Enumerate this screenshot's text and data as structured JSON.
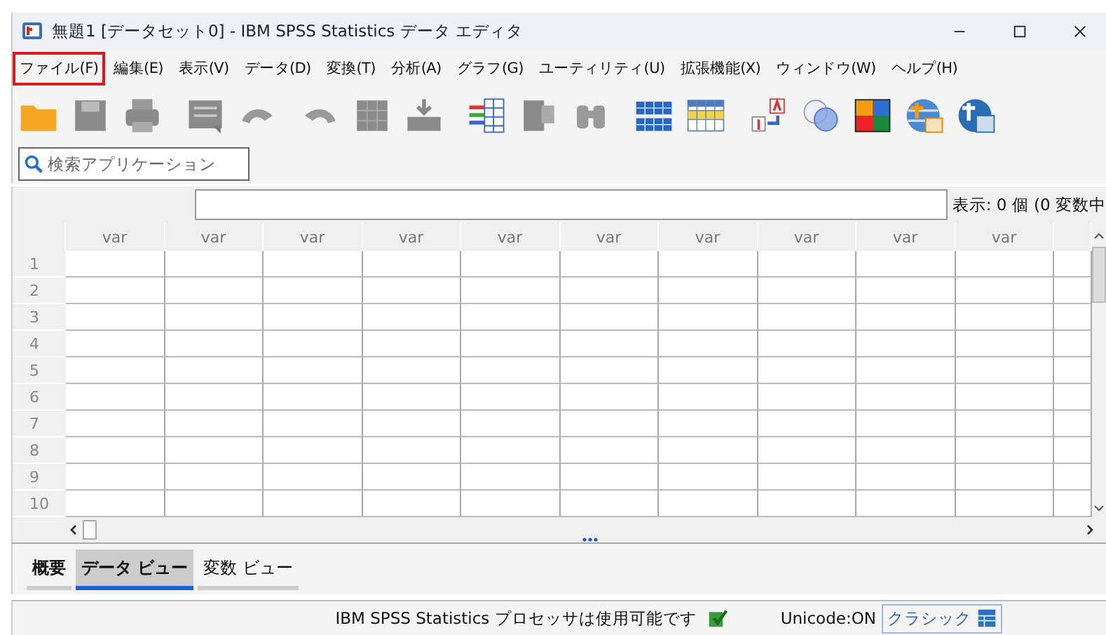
{
  "window": {
    "title": "無題1 [データセット0] - IBM SPSS Statistics データ エディタ"
  },
  "menu": [
    {
      "label": "ファイル(F)",
      "highlighted": true
    },
    {
      "label": "編集(E)",
      "highlighted": false
    },
    {
      "label": "表示(V)",
      "highlighted": false
    },
    {
      "label": "データ(D)",
      "highlighted": false
    },
    {
      "label": "変換(T)",
      "highlighted": false
    },
    {
      "label": "分析(A)",
      "highlighted": false
    },
    {
      "label": "グラフ(G)",
      "highlighted": false
    },
    {
      "label": "ユーティリティ(U)",
      "highlighted": false
    },
    {
      "label": "拡張機能(X)",
      "highlighted": false
    },
    {
      "label": "ウィンドウ(W)",
      "highlighted": false
    },
    {
      "label": "ヘルプ(H)",
      "highlighted": false
    }
  ],
  "search": {
    "placeholder": "検索アプリケーション"
  },
  "visible_count": "表示: 0 個 (0 変数中",
  "table": {
    "columns": [
      "var",
      "var",
      "var",
      "var",
      "var",
      "var",
      "var",
      "var",
      "var",
      "var"
    ],
    "rows": [
      "1",
      "2",
      "3",
      "4",
      "5",
      "6",
      "7",
      "8",
      "9",
      "10"
    ]
  },
  "tabs": [
    {
      "label": "概要",
      "selected": false
    },
    {
      "label": "データ ビュー",
      "selected": true
    },
    {
      "label": "変数 ビュー",
      "selected": false
    }
  ],
  "status_bar": {
    "processor": "IBM SPSS Statistics プロセッサは使用可能です",
    "unicode": "Unicode:ON",
    "mode": "クラシック"
  }
}
